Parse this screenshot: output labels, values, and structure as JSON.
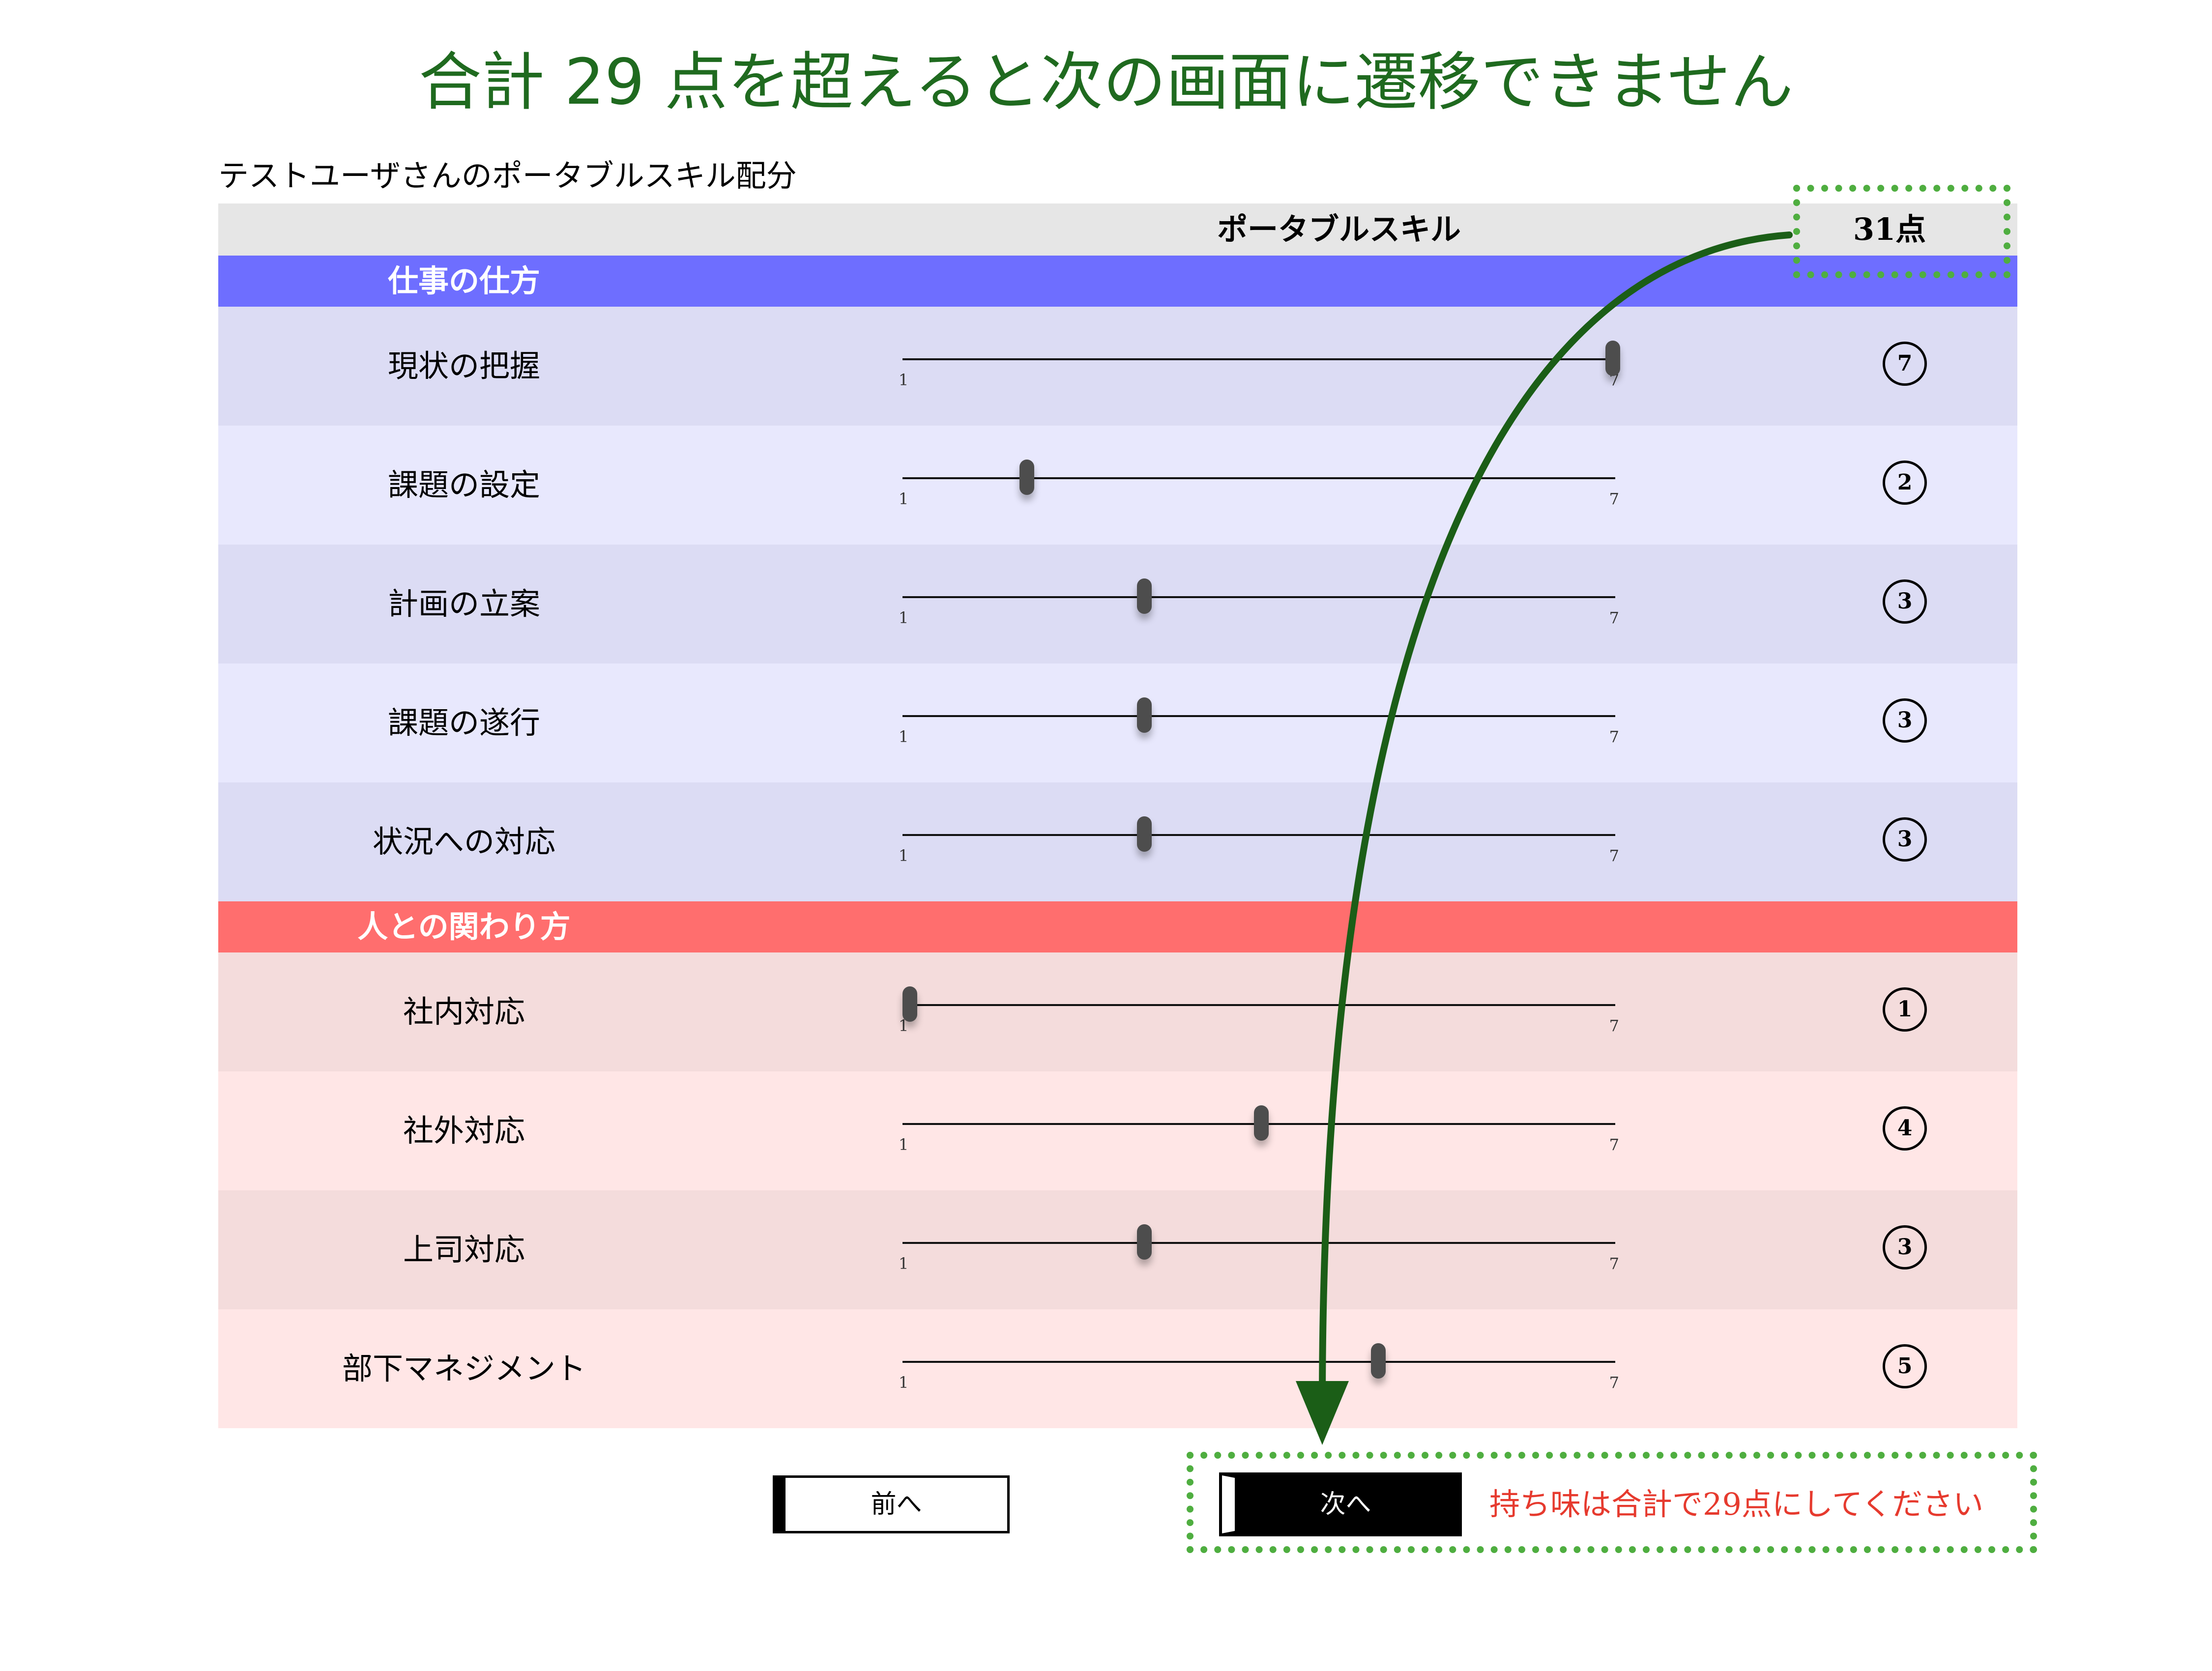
{
  "headline": "合計 29 点を超えると次の画面に遷移できません",
  "panel_title": "テストユーザさんのポータブルスキル配分",
  "table": {
    "col_title": "ポータブルスキル",
    "total": "31点"
  },
  "slider_min_label": "1",
  "slider_max_label": "7",
  "slider_min": 1,
  "slider_max": 7,
  "sections": [
    {
      "title": "仕事の仕方",
      "header_color": "#6e6eff",
      "row_colors": [
        "#dcdcf4",
        "#e8e8fd"
      ],
      "items": [
        {
          "label": "現状の把握",
          "value": 7,
          "display": "7"
        },
        {
          "label": "課題の設定",
          "value": 2,
          "display": "2"
        },
        {
          "label": "計画の立案",
          "value": 3,
          "display": "3"
        },
        {
          "label": "課題の遂行",
          "value": 3,
          "display": "3"
        },
        {
          "label": "状況への対応",
          "value": 3,
          "display": "3"
        }
      ]
    },
    {
      "title": "人との関わり方",
      "header_color": "#ff6e6e",
      "row_colors": [
        "#f4dcdc",
        "#ffe6e6"
      ],
      "items": [
        {
          "label": "社内対応",
          "value": 1,
          "display": "1"
        },
        {
          "label": "社外対応",
          "value": 4,
          "display": "4"
        },
        {
          "label": "上司対応",
          "value": 3,
          "display": "3"
        },
        {
          "label": "部下マネジメント",
          "value": 5,
          "display": "5"
        }
      ]
    }
  ],
  "buttons": {
    "prev_label": "前へ",
    "next_label": "次へ"
  },
  "warning": "持ち味は合計で29点にしてください",
  "annotation_color": "#1b5e17",
  "highlight_color": "#4fae40"
}
